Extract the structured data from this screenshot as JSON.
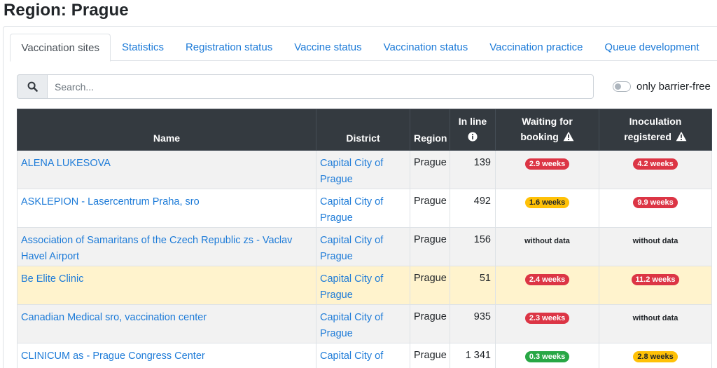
{
  "page": {
    "title": "Region: Prague"
  },
  "tabs": [
    {
      "label": "Vaccination sites",
      "active": true
    },
    {
      "label": "Statistics"
    },
    {
      "label": "Registration status"
    },
    {
      "label": "Vaccine status"
    },
    {
      "label": "Vaccination status"
    },
    {
      "label": "Vaccination practice"
    },
    {
      "label": "Queue development"
    }
  ],
  "search": {
    "placeholder": "Search...",
    "value": "",
    "icon": "search-icon"
  },
  "filter": {
    "label": "only barrier-free",
    "checked": false
  },
  "table": {
    "headers": {
      "name": "Name",
      "district": "District",
      "region": "Region",
      "in_line": "In line",
      "waiting_line1": "Waiting for",
      "waiting_line2": "booking",
      "inoculation_line1": "Inoculation",
      "inoculation_line2": "registered"
    },
    "rows": [
      {
        "name": "ALENA LUKESOVA",
        "district": "Capital City of Prague",
        "region": "Prague",
        "in_line": "139",
        "waiting": "2.9 weeks",
        "waiting_status": "red",
        "inoculation": "4.2 weeks",
        "inoculation_status": "red"
      },
      {
        "name": "ASKLEPION - Lasercentrum Praha, sro",
        "district": "Capital City of Prague",
        "region": "Prague",
        "in_line": "492",
        "waiting": "1.6 weeks",
        "waiting_status": "yellow",
        "inoculation": "9.9 weeks",
        "inoculation_status": "red"
      },
      {
        "name": "Association of Samaritans of the Czech Republic zs - Vaclav Havel Airport",
        "district": "Capital City of Prague",
        "region": "Prague",
        "in_line": "156",
        "waiting": "without data",
        "waiting_status": "none",
        "inoculation": "without data",
        "inoculation_status": "none"
      },
      {
        "name": "Be Elite Clinic",
        "district": "Capital City of Prague",
        "region": "Prague",
        "in_line": "51",
        "waiting": "2.4 weeks",
        "waiting_status": "red",
        "inoculation": "11.2 weeks",
        "inoculation_status": "red",
        "highlighted": true
      },
      {
        "name": "Canadian Medical sro, vaccination center",
        "district": "Capital City of Prague",
        "region": "Prague",
        "in_line": "935",
        "waiting": "2.3 weeks",
        "waiting_status": "red",
        "inoculation": "without data",
        "inoculation_status": "none"
      },
      {
        "name": "CLINICUM as - Prague Congress Center",
        "district": "Capital City of Prague",
        "region": "Prague",
        "in_line": "1 341",
        "waiting": "0.3 weeks",
        "waiting_status": "green",
        "inoculation": "2.8 weeks",
        "inoculation_status": "yellow"
      }
    ]
  },
  "colors": {
    "link": "#1d7bd8",
    "header_bg": "#343a40",
    "red": "#dc3545",
    "yellow": "#ffc107",
    "green": "#28a745",
    "highlight": "#fff3cd"
  }
}
